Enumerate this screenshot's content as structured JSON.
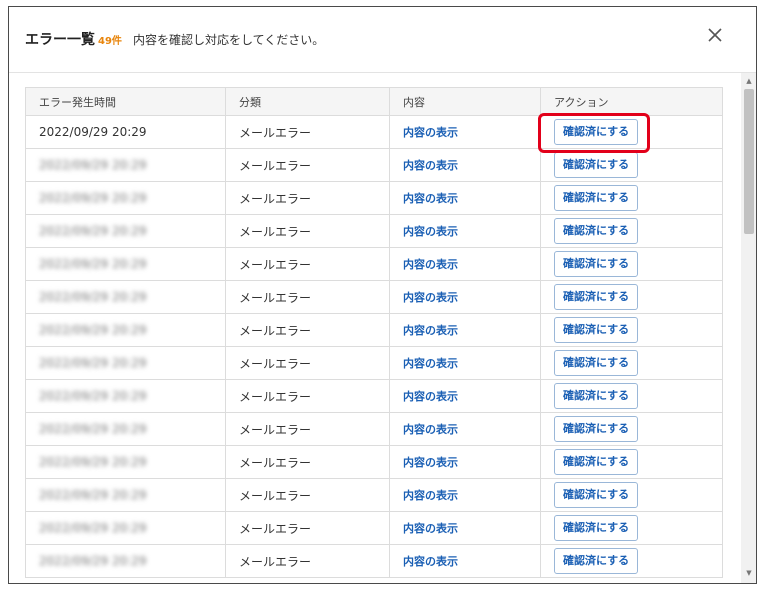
{
  "header": {
    "title": "エラー一覧",
    "count": "49件",
    "description": "内容を確認し対応をしてください。",
    "close_icon": "close-icon"
  },
  "table": {
    "columns": [
      "エラー発生時間",
      "分類",
      "内容",
      "アクション"
    ],
    "rows": [
      {
        "time": "2022/09/29 20:29",
        "category": "メールエラー",
        "content": "内容の表示",
        "action": "確認済にする"
      },
      {
        "time": "2022/09/29 20:29",
        "category": "メールエラー",
        "content": "内容の表示",
        "action": "確認済にする"
      },
      {
        "time": "2022/09/29 20:29",
        "category": "メールエラー",
        "content": "内容の表示",
        "action": "確認済にする"
      },
      {
        "time": "2022/09/29 20:29",
        "category": "メールエラー",
        "content": "内容の表示",
        "action": "確認済にする"
      },
      {
        "time": "2022/09/29 20:29",
        "category": "メールエラー",
        "content": "内容の表示",
        "action": "確認済にする"
      },
      {
        "time": "2022/09/29 20:29",
        "category": "メールエラー",
        "content": "内容の表示",
        "action": "確認済にする"
      },
      {
        "time": "2022/09/29 20:29",
        "category": "メールエラー",
        "content": "内容の表示",
        "action": "確認済にする"
      },
      {
        "time": "2022/09/29 20:29",
        "category": "メールエラー",
        "content": "内容の表示",
        "action": "確認済にする"
      },
      {
        "time": "2022/09/29 20:29",
        "category": "メールエラー",
        "content": "内容の表示",
        "action": "確認済にする"
      },
      {
        "time": "2022/09/29 20:29",
        "category": "メールエラー",
        "content": "内容の表示",
        "action": "確認済にする"
      },
      {
        "time": "2022/09/29 20:29",
        "category": "メールエラー",
        "content": "内容の表示",
        "action": "確認済にする"
      },
      {
        "time": "2022/09/29 20:29",
        "category": "メールエラー",
        "content": "内容の表示",
        "action": "確認済にする"
      },
      {
        "time": "2022/09/29 20:29",
        "category": "メールエラー",
        "content": "内容の表示",
        "action": "確認済にする"
      },
      {
        "time": "2022/09/29 20:29",
        "category": "メールエラー",
        "content": "内容の表示",
        "action": "確認済にする"
      }
    ]
  },
  "colors": {
    "accent": "#1a5fb4",
    "count": "#e8850c",
    "highlight": "#e2001a"
  }
}
